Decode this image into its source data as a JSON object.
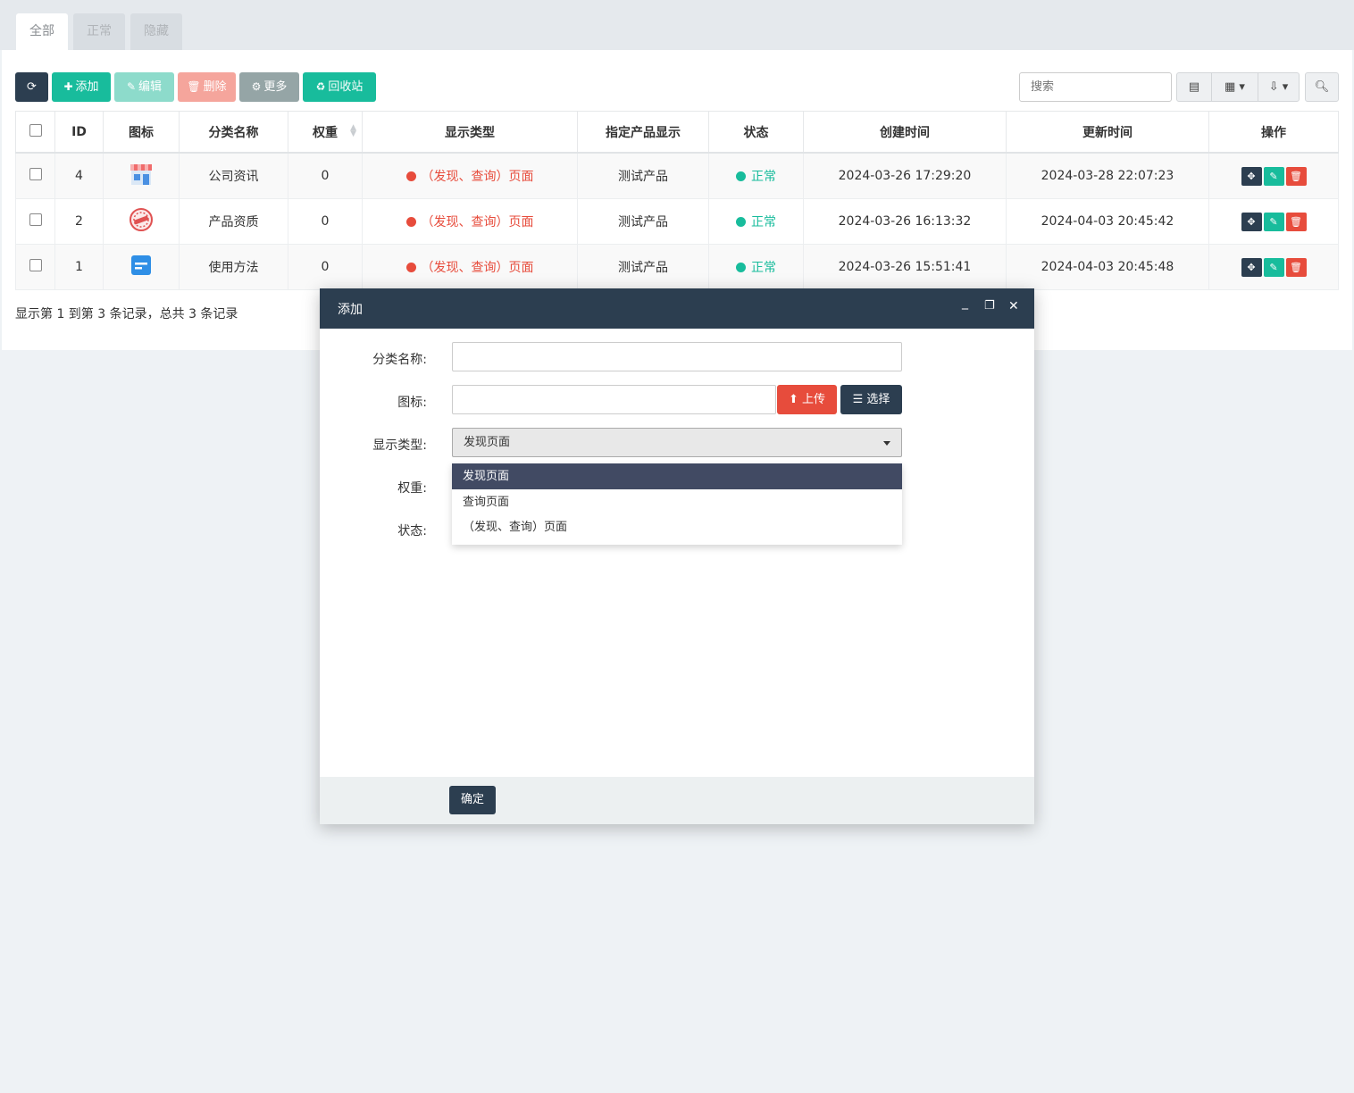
{
  "tabs": [
    "全部",
    "正常",
    "隐藏"
  ],
  "toolbar": {
    "add": "添加",
    "edit": "编辑",
    "delete": "删除",
    "more": "更多",
    "recycle": "回收站",
    "search_placeholder": "搜索"
  },
  "table": {
    "headers": [
      "ID",
      "图标",
      "分类名称",
      "权重",
      "显示类型",
      "指定产品显示",
      "状态",
      "创建时间",
      "更新时间",
      "操作"
    ],
    "rows": [
      {
        "id": "4",
        "icon": "shop-icon",
        "name": "公司资讯",
        "weight": "0",
        "type": "（发现、查询）页面",
        "product": "测试产品",
        "status": "正常",
        "created": "2024-03-26 17:29:20",
        "updated": "2024-03-28 22:07:23"
      },
      {
        "id": "2",
        "icon": "seal-icon",
        "name": "产品资质",
        "weight": "0",
        "type": "（发现、查询）页面",
        "product": "测试产品",
        "status": "正常",
        "created": "2024-03-26 16:13:32",
        "updated": "2024-04-03 20:45:42"
      },
      {
        "id": "1",
        "icon": "card-icon",
        "name": "使用方法",
        "weight": "0",
        "type": "（发现、查询）页面",
        "product": "测试产品",
        "status": "正常",
        "created": "2024-03-26 15:51:41",
        "updated": "2024-04-03 20:45:48"
      }
    ]
  },
  "pagination_text": "显示第 1 到第 3 条记录，总共 3 条记录",
  "modal": {
    "title": "添加",
    "labels": {
      "name": "分类名称:",
      "icon": "图标:",
      "type": "显示类型:",
      "weight": "权重:",
      "status": "状态:"
    },
    "upload": "上传",
    "choose": "选择",
    "type_selected": "发现页面",
    "type_options": [
      "发现页面",
      "查询页面",
      "（发现、查询）页面"
    ],
    "ok": "确定"
  },
  "colors": {
    "primary": "#2c3e50",
    "success": "#18bc9c",
    "danger": "#e74c3c"
  }
}
